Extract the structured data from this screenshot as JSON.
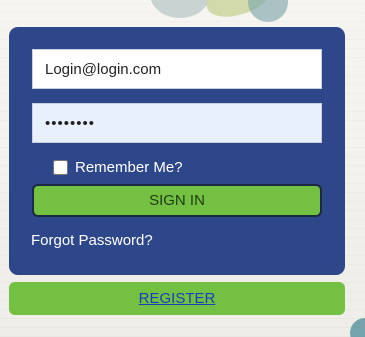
{
  "login_form": {
    "username_value": "Login@login.com",
    "password_value": "password",
    "remember_label": "Remember Me?",
    "remember_checked": false,
    "signin_label": "SIGN IN",
    "forgot_label": "Forgot Password?"
  },
  "register": {
    "label": "REGISTER"
  },
  "colors": {
    "panel": "#2e478a",
    "button_green": "#74c043",
    "link_blue": "#1a3fbe",
    "autofill_bg": "#e8f0fe"
  }
}
